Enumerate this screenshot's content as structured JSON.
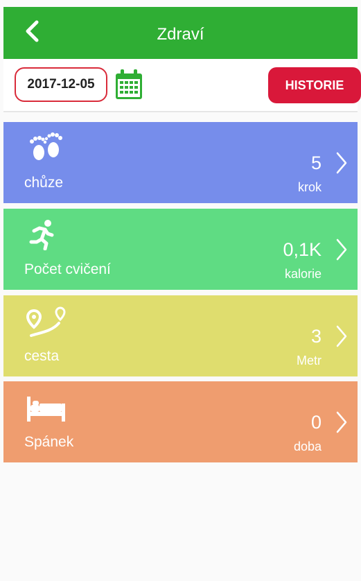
{
  "header": {
    "title": "Zdraví",
    "back_icon": "chevron-left-icon",
    "color": "#2fae34"
  },
  "datebar": {
    "date": "2017-12-05",
    "calendar_icon": "calendar-icon",
    "history_label": "HISTORIE",
    "history_color": "#d9183a",
    "date_border_color": "#d92b3a"
  },
  "cards": [
    {
      "label": "chůze",
      "value": "5",
      "unit": "krok",
      "color": "#768deb",
      "icon": "footprints-icon"
    },
    {
      "label": "Počet cvičení",
      "value": "0,1K",
      "unit": "kalorie",
      "color": "#5fdc83",
      "icon": "running-person-icon"
    },
    {
      "label": "cesta",
      "value": "3",
      "unit": "Metr",
      "color": "#dfdd6e",
      "icon": "route-pin-icon"
    },
    {
      "label": "Spánek",
      "value": "0",
      "unit": "doba",
      "color": "#ef9d6f",
      "icon": "bed-icon"
    }
  ]
}
